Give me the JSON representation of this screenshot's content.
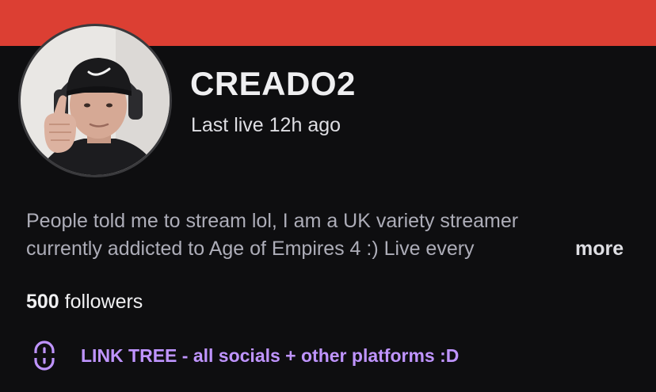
{
  "banner": {
    "color": "#dc3f33"
  },
  "profile": {
    "avatar_icon": "streamer-avatar-photo",
    "name": "CREADO2",
    "last_live": "Last live 12h ago"
  },
  "bio": {
    "line1": "People told me to stream lol,  I am a UK variety streamer",
    "line2": "currently addicted to Age of Empires 4 :)  Live every",
    "more_label": "more"
  },
  "followers": {
    "count": "500",
    "label": " followers"
  },
  "link": {
    "icon": "link-icon",
    "text": "LINK TREE - all socials + other platforms :D",
    "color": "#bf94ff"
  }
}
